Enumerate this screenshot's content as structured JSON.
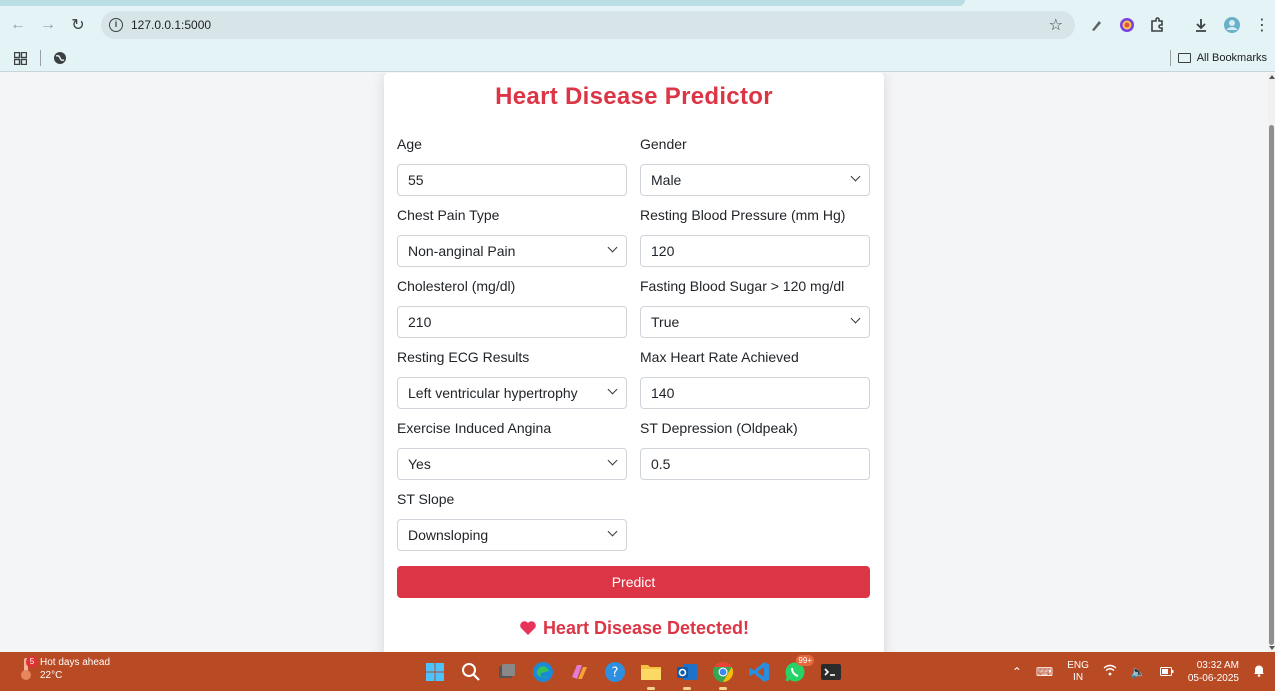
{
  "browser": {
    "url": "127.0.0.1:5000",
    "bookmarks_label": "All Bookmarks"
  },
  "form": {
    "title": "Heart Disease Predictor",
    "fields": {
      "age": {
        "label": "Age",
        "value": "55"
      },
      "gender": {
        "label": "Gender",
        "value": "Male"
      },
      "chest_pain": {
        "label": "Chest Pain Type",
        "value": "Non-anginal Pain"
      },
      "resting_bp": {
        "label": "Resting Blood Pressure (mm Hg)",
        "value": "120"
      },
      "cholesterol": {
        "label": "Cholesterol (mg/dl)",
        "value": "210"
      },
      "fasting_bs": {
        "label": "Fasting Blood Sugar > 120 mg/dl",
        "value": "True"
      },
      "resting_ecg": {
        "label": "Resting ECG Results",
        "value": "Left ventricular hypertrophy"
      },
      "max_hr": {
        "label": "Max Heart Rate Achieved",
        "value": "140"
      },
      "exercise_angina": {
        "label": "Exercise Induced Angina",
        "value": "Yes"
      },
      "oldpeak": {
        "label": "ST Depression (Oldpeak)",
        "value": "0.5"
      },
      "st_slope": {
        "label": "ST Slope",
        "value": "Downsloping"
      }
    },
    "predict_label": "Predict",
    "result_icon": "heart-icon",
    "result_text": "Heart Disease Detected!",
    "accent_color": "#dc3545"
  },
  "taskbar": {
    "weather_badge": "5",
    "weather_title": "Hot days ahead",
    "weather_temp": "22°C",
    "whatsapp_badge": "99+",
    "lang_line1": "ENG",
    "lang_line2": "IN",
    "time": "03:32 AM",
    "date": "05-06-2025"
  }
}
